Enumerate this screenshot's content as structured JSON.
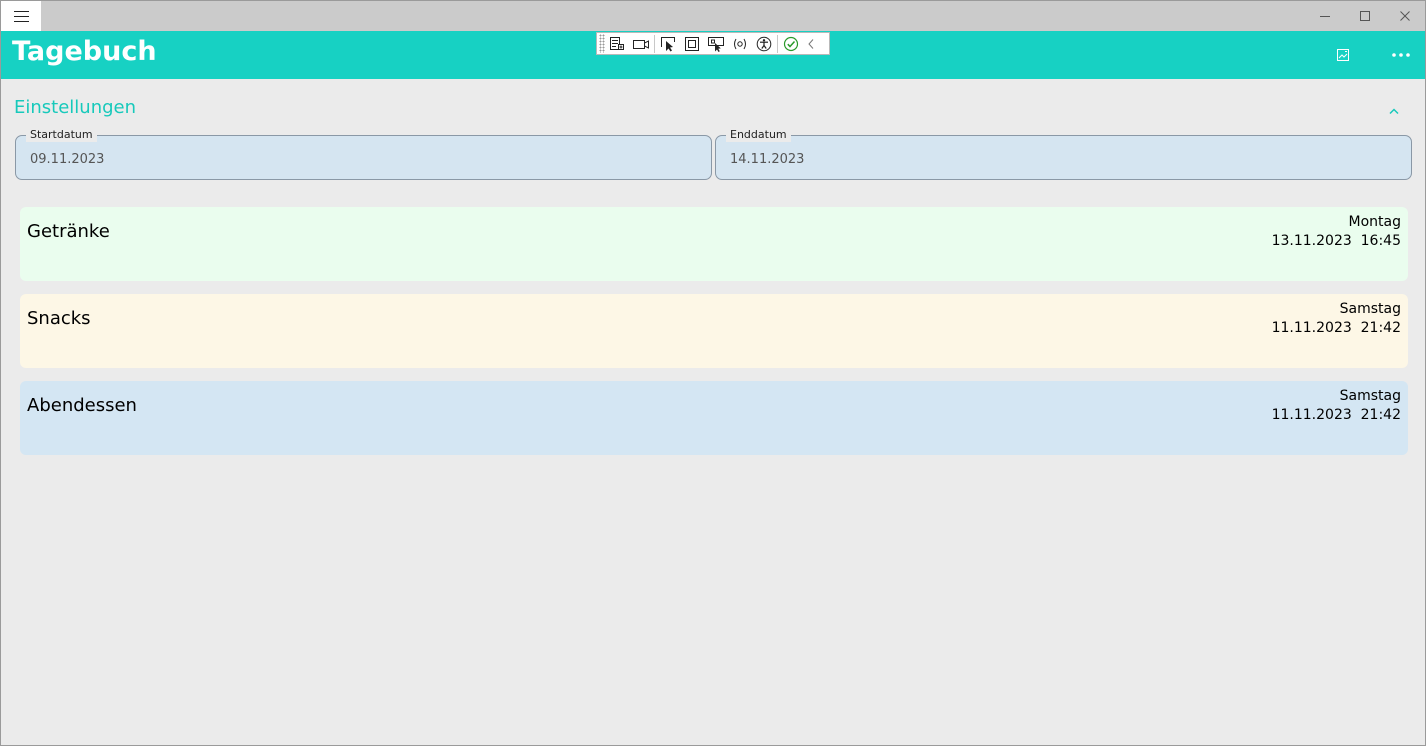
{
  "app": {
    "title": "Tagebuch"
  },
  "colors": {
    "accent": "#17d1c3",
    "card_getraenke": "#eafdee",
    "card_snacks": "#fdf7e6",
    "card_abendessen": "#d4e6f3"
  },
  "icons": {
    "menu": "hamburger-menu-icon",
    "minimize": "minimize-icon",
    "maximize": "maximize-icon",
    "close": "close-icon",
    "export": "export-image-icon",
    "more": "more-options-icon",
    "collapse": "chevron-up-icon"
  },
  "settings": {
    "header": "Einstellungen",
    "start_label": "Startdatum",
    "start_value": "09.11.2023",
    "end_label": "Enddatum",
    "end_value": "14.11.2023"
  },
  "entries": [
    {
      "title": "Getränke",
      "day": "Montag",
      "datetime": "13.11.2023  16:45"
    },
    {
      "title": "Snacks",
      "day": "Samstag",
      "datetime": "11.11.2023  21:42"
    },
    {
      "title": "Abendessen",
      "day": "Samstag",
      "datetime": "11.11.2023  21:42"
    }
  ]
}
